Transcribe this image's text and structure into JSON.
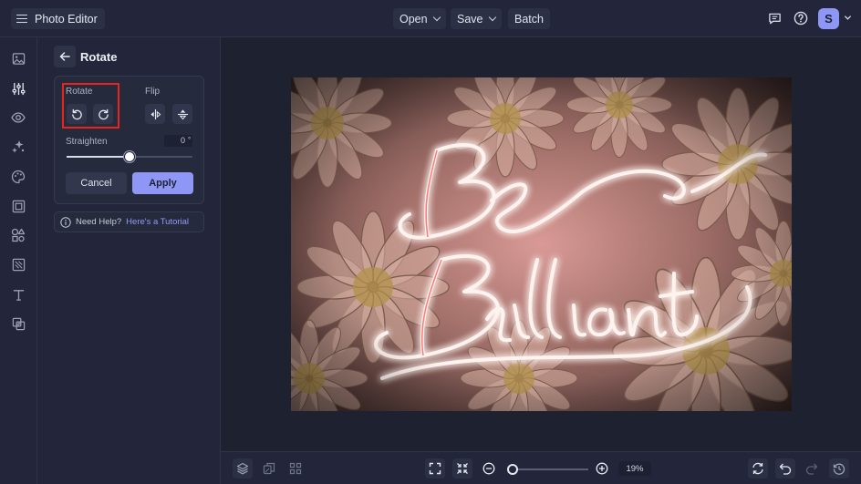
{
  "header": {
    "app_title": "Photo Editor",
    "menus": [
      {
        "label": "Open",
        "has_caret": true
      },
      {
        "label": "Save",
        "has_caret": true
      },
      {
        "label": "Batch",
        "has_caret": false
      }
    ],
    "avatar_initial": "S"
  },
  "sidebar": {
    "items": [
      {
        "icon": "image-icon"
      },
      {
        "icon": "adjustments-icon",
        "active": true
      },
      {
        "icon": "eye-icon"
      },
      {
        "icon": "sparkle-effects-icon"
      },
      {
        "icon": "palette-icon"
      },
      {
        "icon": "frame-icon"
      },
      {
        "icon": "shapes-icon"
      },
      {
        "icon": "texture-icon"
      },
      {
        "icon": "text-icon"
      },
      {
        "icon": "overlay-icon"
      }
    ]
  },
  "panel": {
    "title": "Rotate",
    "rotate_label": "Rotate",
    "flip_label": "Flip",
    "straighten_label": "Straighten",
    "straighten_value": "0",
    "degree_symbol": "°",
    "straighten_position": 0.5,
    "cancel_label": "Cancel",
    "apply_label": "Apply",
    "help_text": "Need Help?",
    "help_link": "Here's a Tutorial"
  },
  "canvas": {
    "image_text": [
      "Be",
      "Brilliant"
    ]
  },
  "bottom": {
    "zoom_value": "19%",
    "zoom_position": 0.02
  },
  "colors": {
    "accent": "#8f97f6",
    "highlight_box": "#e8241b",
    "bg": "#1f2231",
    "neon": "#ff6a6a"
  }
}
